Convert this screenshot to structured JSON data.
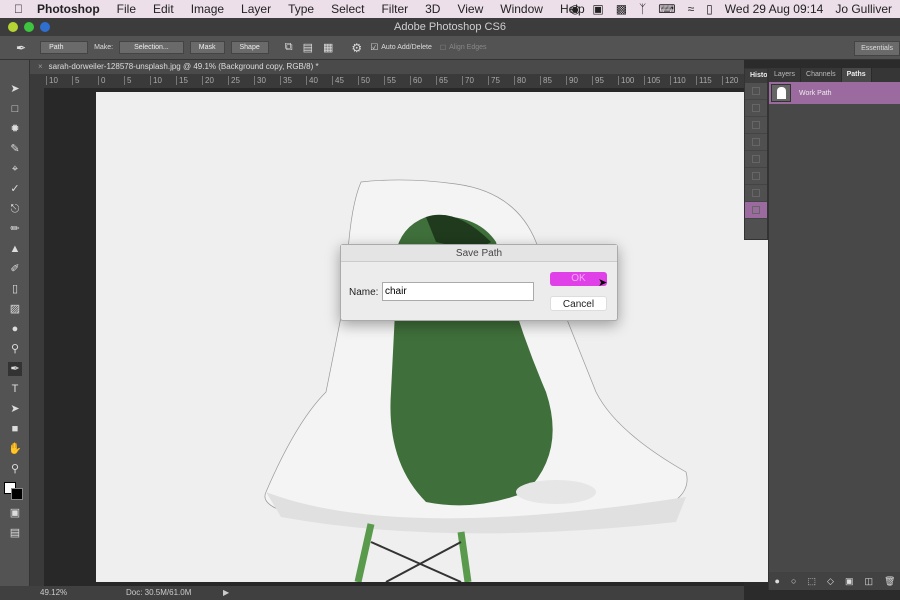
{
  "menubar": {
    "app": "Photoshop",
    "items": [
      "File",
      "Edit",
      "Image",
      "Layer",
      "Type",
      "Select",
      "Filter",
      "3D",
      "View",
      "Window",
      "Help"
    ],
    "datetime": "Wed 29 Aug  09:14",
    "user": "Jo Gulliver"
  },
  "window": {
    "title": "Adobe Photoshop CS6"
  },
  "options": {
    "mode": "Path",
    "make_label": "Make:",
    "selection": "Selection...",
    "mask": "Mask",
    "shape": "Shape",
    "auto_add_delete": "Auto Add/Delete",
    "align_edges": "Align Edges",
    "auto_checked": true,
    "workspace": "Essentials"
  },
  "document": {
    "tab": "sarah-dorweiler-128578-unsplash.jpg @ 49.1% (Background copy, RGB/8) *",
    "ruler_ticks": [
      "10",
      "5",
      "0",
      "5",
      "10",
      "15",
      "20",
      "25",
      "30",
      "35",
      "40",
      "45",
      "50",
      "55",
      "60",
      "65",
      "70",
      "75",
      "80",
      "85",
      "90",
      "95",
      "100",
      "105",
      "110",
      "115",
      "120"
    ]
  },
  "status": {
    "zoom": "49.12%",
    "doc": "Doc: 30.5M/61.0M"
  },
  "history": {
    "tab": "History"
  },
  "panel": {
    "tabs": [
      "Layers",
      "Channels",
      "Paths"
    ],
    "active": "Paths",
    "paths": [
      {
        "name": "Work Path",
        "selected": true
      }
    ]
  },
  "dialog": {
    "title": "Save Path",
    "name_label": "Name:",
    "name_value": "chair",
    "ok": "OK",
    "cancel": "Cancel"
  },
  "colors": {
    "accent": "#e040e8",
    "selection": "#9b6a9e"
  }
}
